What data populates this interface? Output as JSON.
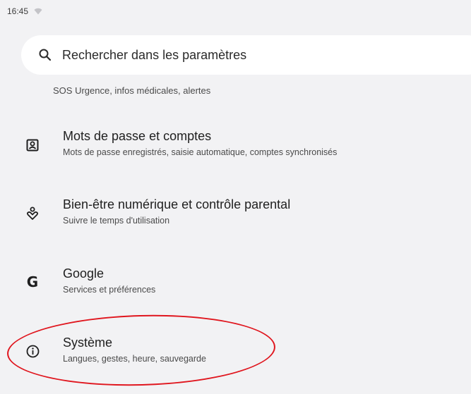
{
  "status_bar": {
    "time": "16:45",
    "icons": [
      "wifi-icon"
    ]
  },
  "search": {
    "placeholder": "Rechercher dans les paramètres",
    "icon": "search-icon"
  },
  "partial_item": {
    "summary": "SOS Urgence, infos médicales, alertes"
  },
  "settings": [
    {
      "icon": "account-box-icon",
      "title": "Mots de passe et comptes",
      "summary": "Mots de passe enregistrés, saisie automatique, comptes synchronisés"
    },
    {
      "icon": "digital-wellbeing-icon",
      "title": "Bien-être numérique et contrôle parental",
      "summary": "Suivre le temps d'utilisation"
    },
    {
      "icon": "google-icon",
      "icon_glyph": "G",
      "title": "Google",
      "summary": "Services et préférences"
    },
    {
      "icon": "info-icon",
      "title": "Système",
      "summary": "Langues, gestes, heure, sauvegarde"
    }
  ],
  "annotation": {
    "shape": "ellipse",
    "target": "Système",
    "color": "#e0161e"
  },
  "colors": {
    "background": "#f2f2f4",
    "search_bar": "#ffffff",
    "text_primary": "#1f1f1f",
    "text_secondary": "#4a4a4a"
  }
}
